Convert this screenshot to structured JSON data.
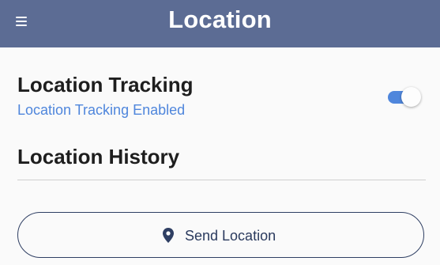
{
  "header": {
    "title": "Location",
    "menu_icon": "hamburger-menu-icon",
    "background_color": "#5c6c94"
  },
  "tracking": {
    "title": "Location Tracking",
    "status": "Location Tracking Enabled",
    "toggle_on": true,
    "accent_color": "#4f86dc"
  },
  "history": {
    "title": "Location History"
  },
  "send_button": {
    "label": "Send Location",
    "icon": "map-pin-icon"
  }
}
